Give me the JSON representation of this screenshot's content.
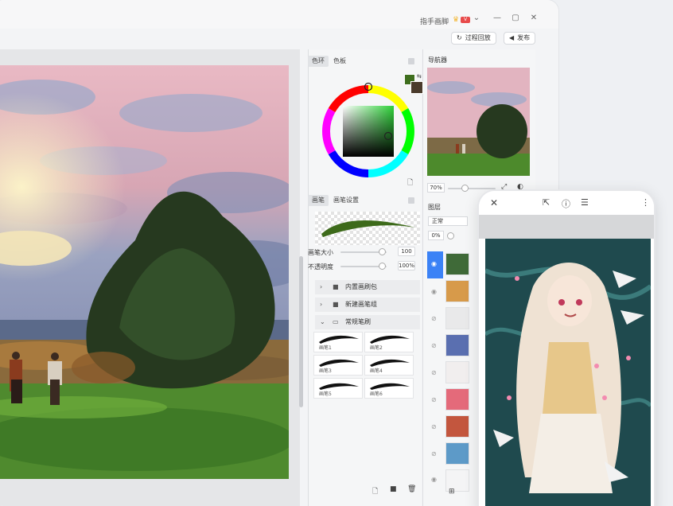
{
  "titlebar": {
    "app_name": "指手画脚",
    "crown_icon": "crown-icon",
    "vip_badge": "V",
    "dropdown_icon": "chevron-down-icon",
    "controls": [
      "—",
      "▢",
      "✕"
    ]
  },
  "toolbar": {
    "replay_label": "过程回放",
    "publish_label": "发布"
  },
  "color_panel": {
    "tabs": [
      "色环",
      "色板"
    ],
    "foreground_color": "#3e6e1e",
    "background_color": "#4a3b2c"
  },
  "brush_panel": {
    "tabs": [
      "画笔",
      "画笔设置"
    ],
    "stroke_color": "#3d6a1a",
    "size_label": "画笔大小",
    "size_value": "100",
    "opacity_label": "不透明度",
    "opacity_value": "100%",
    "size_level": 0.9,
    "opacity_level": 0.9,
    "folders": [
      {
        "label": "内置画刷包",
        "expanded": false
      },
      {
        "label": "新建画笔组",
        "expanded": false
      },
      {
        "label": "常规笔刷",
        "expanded": true
      }
    ],
    "brushes": [
      "画笔1",
      "画笔2",
      "画笔3",
      "画笔4",
      "画笔5",
      "画笔6"
    ]
  },
  "navigator": {
    "title": "导航器",
    "zoom": "70%",
    "zoom_level": 0.35
  },
  "layers": {
    "title": "图层",
    "blend_mode": "正常",
    "opacity": "0%"
  },
  "colors": {
    "accent": "#3b82f6"
  }
}
